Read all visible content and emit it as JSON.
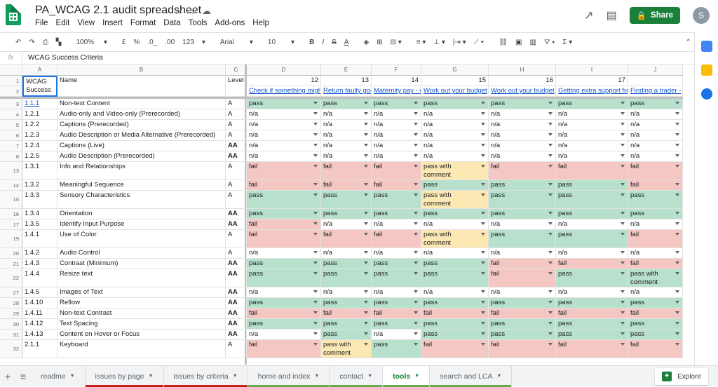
{
  "header": {
    "doc_title": "PA_WCAG 2.1 audit spreadsheet",
    "menu": [
      "File",
      "Edit",
      "View",
      "Insert",
      "Format",
      "Data",
      "Tools",
      "Add-ons",
      "Help"
    ],
    "share_label": "Share",
    "avatar_initial": "S"
  },
  "toolbar": {
    "zoom": "100%",
    "currency": "£",
    "percent": "%",
    "dec_less": ".0_",
    "dec_more": ".00",
    "format_more": "123",
    "font": "Arial",
    "font_size": "10",
    "bold": "B",
    "italic": "I",
    "strike": "S",
    "text_color": "A"
  },
  "formula_bar": {
    "fx": "fx",
    "content": "WCAG Success Criteria"
  },
  "columns": [
    "A",
    "B",
    "C",
    "D",
    "E",
    "F",
    "G",
    "H",
    "I",
    "J"
  ],
  "row1": [
    "WCAG Success",
    "Name",
    "Level",
    "12",
    "13",
    "14",
    "15",
    "16",
    "17",
    ""
  ],
  "row2_links": [
    "Check if something might",
    "Return faulty goods",
    "Maternity pay - w",
    "Work out your budget",
    "Work out your budget",
    "Getting extra support fro",
    "Finding a trader -"
  ],
  "a1_extra": "Criteria",
  "rows": [
    {
      "num": "3",
      "id": "1.1.1",
      "name": "Non-text Content",
      "level": "A",
      "results": [
        "pass",
        "pass",
        "pass",
        "pass",
        "pass",
        "pass",
        "pass"
      ]
    },
    {
      "num": "4",
      "id": "1.2.1",
      "name": "Audio-only and Video-only (Prerecorded)",
      "level": "A",
      "results": [
        "n/a",
        "n/a",
        "n/a",
        "n/a",
        "n/a",
        "n/a",
        "n/a"
      ]
    },
    {
      "num": "5",
      "id": "1.2.2",
      "name": "Captions (Prerecorded)",
      "level": "A",
      "results": [
        "n/a",
        "n/a",
        "n/a",
        "n/a",
        "n/a",
        "n/a",
        "n/a"
      ]
    },
    {
      "num": "6",
      "id": "1.2.3",
      "name": "Audio Description or Media Alternative (Prerecorded)",
      "level": "A",
      "results": [
        "n/a",
        "n/a",
        "n/a",
        "n/a",
        "n/a",
        "n/a",
        "n/a"
      ]
    },
    {
      "num": "7",
      "id": "1.2.4",
      "name": "Captions (Live)",
      "level": "AA",
      "results": [
        "n/a",
        "n/a",
        "n/a",
        "n/a",
        "n/a",
        "n/a",
        "n/a"
      ]
    },
    {
      "num": "8",
      "id": "1.2.5",
      "name": "Audio Description (Prerecorded)",
      "level": "AA",
      "results": [
        "n/a",
        "n/a",
        "n/a",
        "n/a",
        "n/a",
        "n/a",
        "n/a"
      ]
    },
    {
      "num": "13",
      "id": "1.3.1",
      "name": "Info and Relationships",
      "level": "A",
      "tall": true,
      "results": [
        "fail",
        "fail",
        "fail",
        "pass with comment",
        "fail",
        "fail",
        "fail"
      ]
    },
    {
      "num": "14",
      "id": "1.3.2",
      "name": "Meaningful Sequence",
      "level": "A",
      "results": [
        "fail",
        "fail",
        "fail",
        "pass",
        "pass",
        "pass",
        "fail"
      ]
    },
    {
      "num": "15",
      "id": "1.3.3",
      "name": "Sensory Characteristics",
      "level": "A",
      "tall": true,
      "results": [
        "pass",
        "pass",
        "pass",
        "pass with comment",
        "pass",
        "pass",
        "pass"
      ]
    },
    {
      "num": "16",
      "id": "1.3.4",
      "name": "Orientation",
      "level": "AA",
      "results": [
        "pass",
        "pass",
        "pass",
        "pass",
        "pass",
        "pass",
        "pass"
      ]
    },
    {
      "num": "17",
      "id": "1.3.5",
      "name": "Identify Input Purpose",
      "level": "AA",
      "results": [
        "fail",
        "n/a",
        "n/a",
        "n/a",
        "n/a",
        "n/a",
        "n/a"
      ]
    },
    {
      "num": "19",
      "id": "1.4.1",
      "name": "Use of Color",
      "level": "A",
      "tall": true,
      "results": [
        "fail",
        "fail",
        "fail",
        "pass with comment",
        "pass",
        "pass",
        "fail"
      ]
    },
    {
      "num": "20",
      "id": "1.4.2",
      "name": "Audio Control",
      "level": "A",
      "results": [
        "n/a",
        "n/a",
        "n/a",
        "n/a",
        "n/a",
        "n/a",
        "n/a"
      ]
    },
    {
      "num": "21",
      "id": "1.4.3",
      "name": "Contrast (Minimum)",
      "level": "AA",
      "results": [
        "pass",
        "pass",
        "pass",
        "pass",
        "fail",
        "fail",
        "fail"
      ]
    },
    {
      "num": "22",
      "id": "1.4.4",
      "name": "Resize text",
      "level": "AA",
      "tall": true,
      "results": [
        "pass",
        "pass",
        "pass",
        "pass",
        "fail",
        "pass",
        "pass with comment"
      ]
    },
    {
      "num": "27",
      "id": "1.4.5",
      "name": "Images of Text",
      "level": "AA",
      "results": [
        "n/a",
        "n/a",
        "n/a",
        "n/a",
        "n/a",
        "n/a",
        "n/a"
      ]
    },
    {
      "num": "28",
      "id": "1.4.10",
      "name": "Reflow",
      "level": "AA",
      "results": [
        "pass",
        "pass",
        "pass",
        "pass",
        "pass",
        "pass",
        "pass"
      ]
    },
    {
      "num": "29",
      "id": "1.4.11",
      "name": "Non-text Contrast",
      "level": "AA",
      "results": [
        "fail",
        "fail",
        "fail",
        "fail",
        "fail",
        "fail",
        "fail"
      ]
    },
    {
      "num": "30",
      "id": "1.4.12",
      "name": "Text Spacing",
      "level": "AA",
      "results": [
        "pass",
        "pass",
        "pass",
        "pass",
        "pass",
        "pass",
        "pass"
      ]
    },
    {
      "num": "31",
      "id": "1.4.13",
      "name": "Content on Hover or Focus",
      "level": "AA",
      "results": [
        "n/a",
        "pass",
        "n/a",
        "pass",
        "pass",
        "pass",
        "pass"
      ]
    },
    {
      "num": "32",
      "id": "2.1.1",
      "name": "Keyboard",
      "level": "A",
      "tall": true,
      "results": [
        "fail",
        "pass with comment",
        "pass",
        "fail",
        "fail",
        "fail",
        "fail"
      ]
    }
  ],
  "sheet_tabs": [
    {
      "label": "readme",
      "color": ""
    },
    {
      "label": "issues by page",
      "color": "#c5221f"
    },
    {
      "label": "issues by criteria",
      "color": "#c5221f"
    },
    {
      "label": "home and index",
      "color": "#6aa84f"
    },
    {
      "label": "contact",
      "color": "#6aa84f"
    },
    {
      "label": "tools",
      "color": "#6aa84f",
      "active": true
    },
    {
      "label": "search and LCA",
      "color": "#6aa84f"
    }
  ],
  "explore_label": "Explore",
  "colors": {
    "pass": "#b7e1cd",
    "fail": "#f4c7c3",
    "comment": "#fce8b2",
    "brand": "#0f9d58"
  }
}
